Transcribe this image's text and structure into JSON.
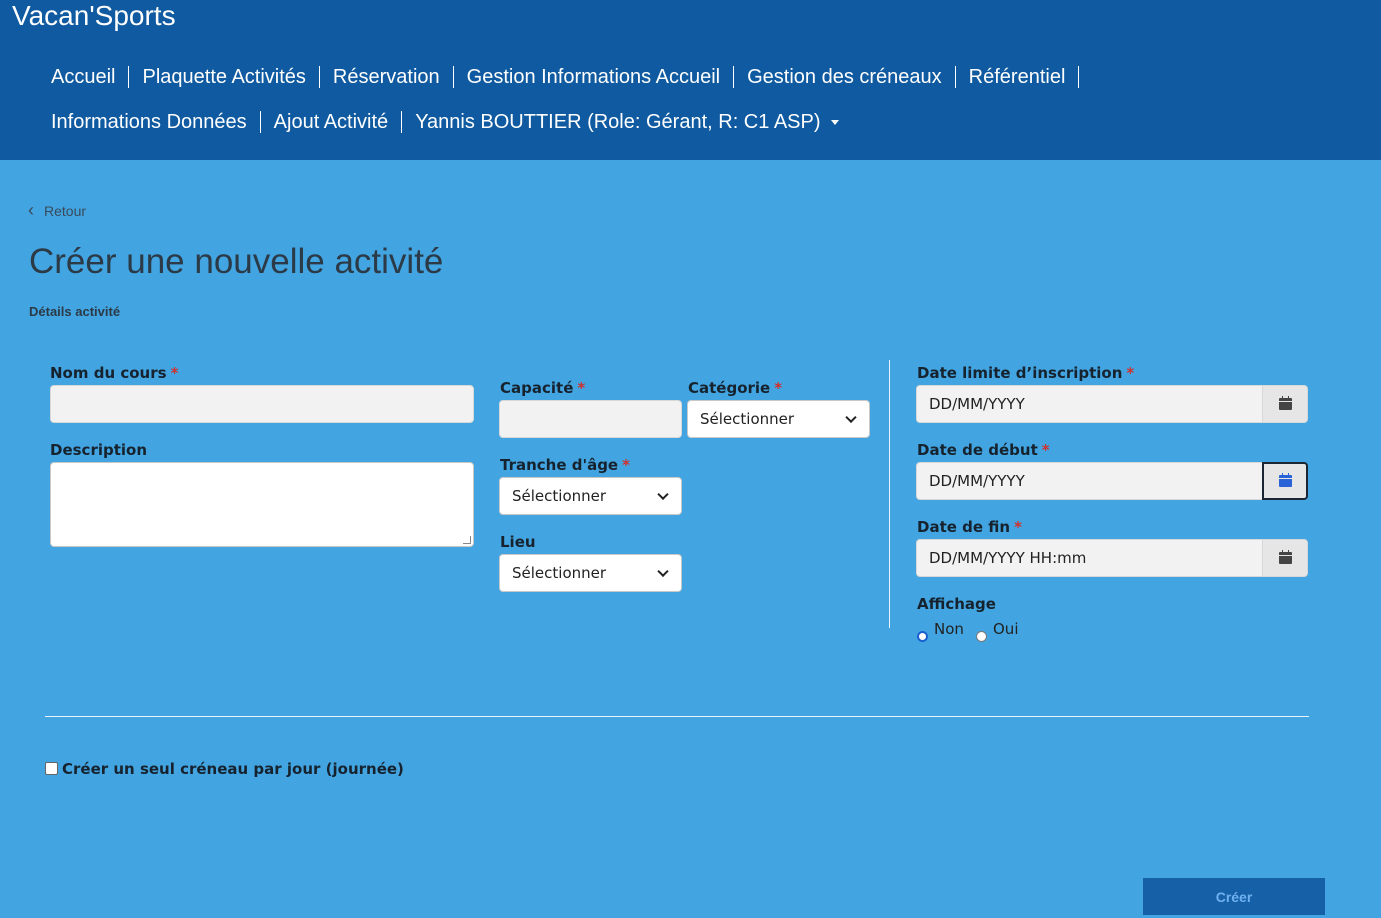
{
  "header": {
    "brand": "Vacan'Sports",
    "nav_row1": [
      "Accueil",
      "Plaquette Activités",
      "Réservation",
      "Gestion Informations Accueil",
      "Gestion des créneaux",
      "Référentiel"
    ],
    "nav_row2": [
      "Informations Données",
      "Ajout Activité"
    ],
    "user_menu": "Yannis BOUTTIER (Role: Gérant, R: C1 ASP)"
  },
  "page": {
    "back_label": "Retour",
    "title": "Créer une nouvelle activité",
    "section": "Détails activité"
  },
  "form": {
    "nom_cours_label": "Nom du cours",
    "description_label": "Description",
    "capacite_label": "Capacité",
    "categorie_label": "Catégorie",
    "categorie_value": "Sélectionner",
    "tranche_age_label": "Tranche d'âge",
    "tranche_age_value": "Sélectionner",
    "lieu_label": "Lieu",
    "lieu_value": "Sélectionner",
    "date_limite_label": "Date limite d’inscription",
    "date_limite_placeholder": "DD/MM/YYYY",
    "date_debut_label": "Date de début",
    "date_debut_placeholder": "DD/MM/YYYY",
    "date_fin_label": "Date de fin",
    "date_fin_placeholder": "DD/MM/YYYY HH:mm",
    "affichage_label": "Affichage",
    "affichage_options": [
      "Non",
      "Oui"
    ],
    "affichage_selected": "Non",
    "required_mark": "*",
    "single_slot_label": "Créer un seul créneau par jour (journée)",
    "single_slot_checked": false,
    "submit_label": "Créer"
  },
  "colors": {
    "header_bg": "#0f5aa0",
    "page_bg": "#42a5e2",
    "required": "#d0312d",
    "button_bg": "#1660a8"
  }
}
